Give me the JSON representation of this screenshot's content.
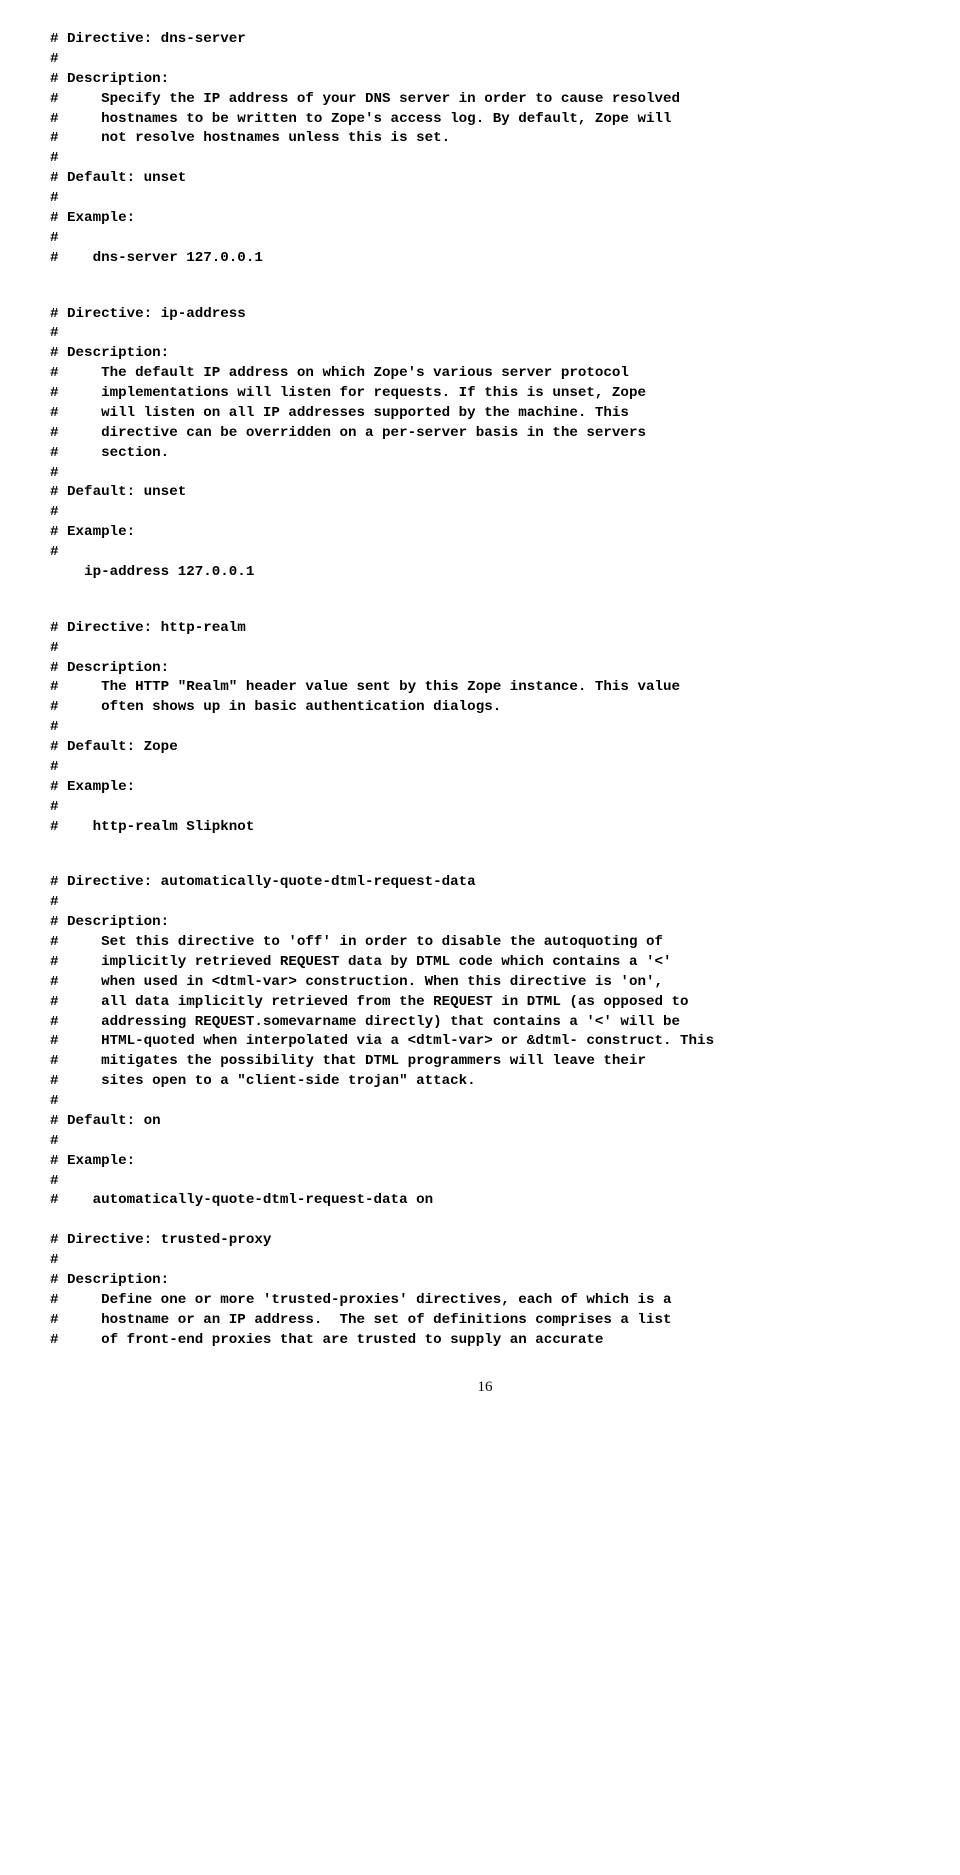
{
  "blocks": [
    "# Directive: dns-server\n#\n# Description:\n#     Specify the IP address of your DNS server in order to cause resolved\n#     hostnames to be written to Zope's access log. By default, Zope will\n#     not resolve hostnames unless this is set.\n#\n# Default: unset\n#\n# Example:\n#\n#    dns-server 127.0.0.1",
    "# Directive: ip-address\n#\n# Description:\n#     The default IP address on which Zope's various server protocol\n#     implementations will listen for requests. If this is unset, Zope\n#     will listen on all IP addresses supported by the machine. This\n#     directive can be overridden on a per-server basis in the servers\n#     section.\n#\n# Default: unset\n#\n# Example:\n#\n    ip-address 127.0.0.1",
    "# Directive: http-realm\n#\n# Description:\n#     The HTTP \"Realm\" header value sent by this Zope instance. This value\n#     often shows up in basic authentication dialogs.\n#\n# Default: Zope\n#\n# Example:\n#\n#    http-realm Slipknot",
    "# Directive: automatically-quote-dtml-request-data\n#\n# Description:\n#     Set this directive to 'off' in order to disable the autoquoting of\n#     implicitly retrieved REQUEST data by DTML code which contains a '<'\n#     when used in <dtml-var> construction. When this directive is 'on',\n#     all data implicitly retrieved from the REQUEST in DTML (as opposed to\n#     addressing REQUEST.somevarname directly) that contains a '<' will be\n#     HTML-quoted when interpolated via a <dtml-var> or &dtml- construct. This\n#     mitigates the possibility that DTML programmers will leave their\n#     sites open to a \"client-side trojan\" attack.\n#\n# Default: on\n#\n# Example:\n#\n#    automatically-quote-dtml-request-data on",
    "# Directive: trusted-proxy\n#\n# Description:\n#     Define one or more 'trusted-proxies' directives, each of which is a\n#     hostname or an IP address.  The set of definitions comprises a list\n#     of front-end proxies that are trusted to supply an accurate"
  ],
  "pageNumber": "16"
}
